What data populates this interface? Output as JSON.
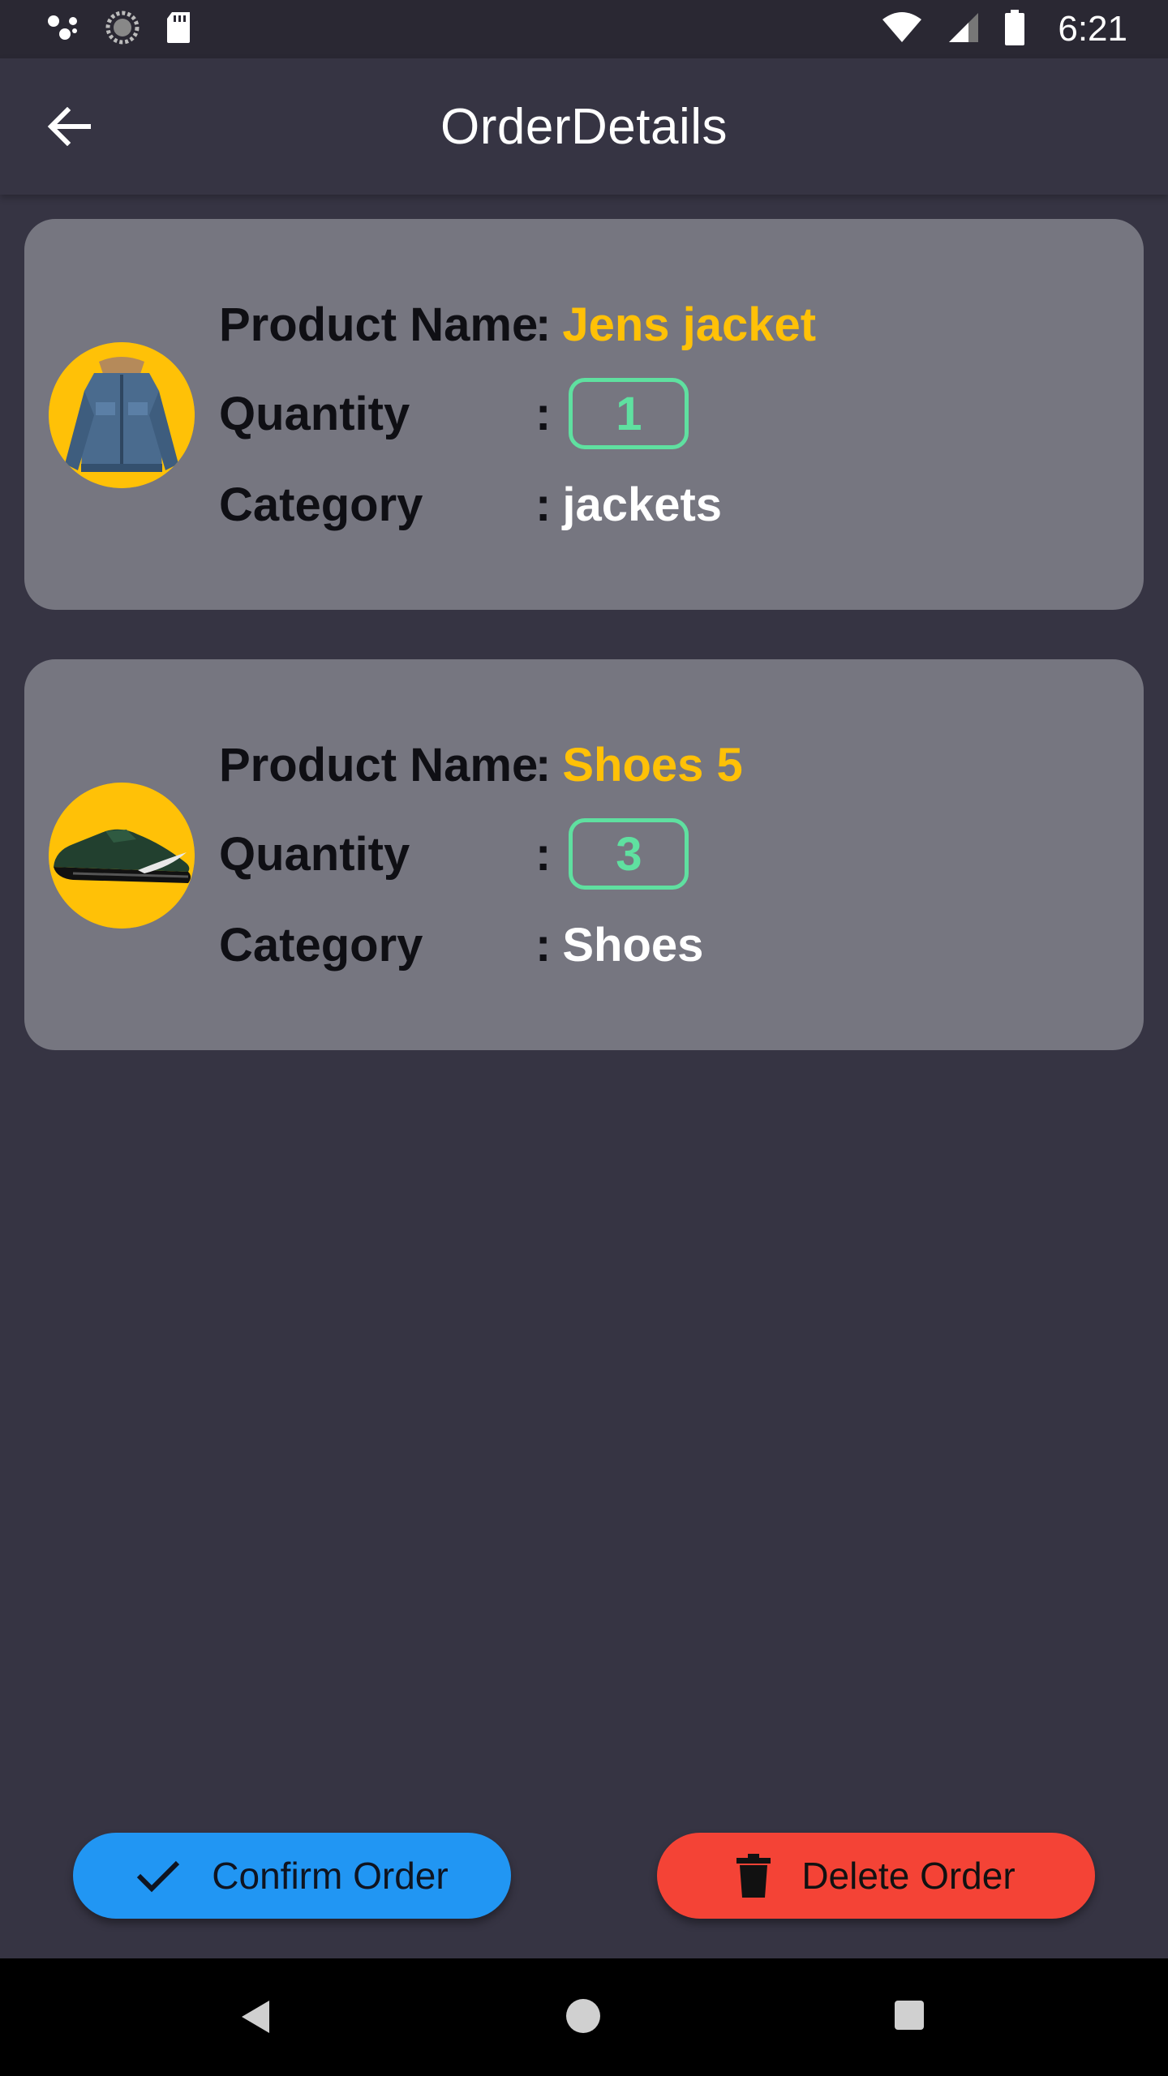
{
  "status_bar": {
    "time": "6:21",
    "icons_left": [
      "assistant-dots-icon",
      "sync-icon",
      "sd-card-icon"
    ],
    "icons_right": [
      "wifi-icon",
      "cell-signal-icon",
      "battery-icon"
    ]
  },
  "app_bar": {
    "title": "OrderDetails",
    "back_icon": "arrow-back-icon"
  },
  "labels": {
    "product_name": "Product Name",
    "quantity": "Quantity",
    "category": "Category",
    "colon": ":"
  },
  "items": [
    {
      "image": "denim-jacket",
      "name": "Jens jacket",
      "quantity": "1",
      "category": "jackets"
    },
    {
      "image": "sneaker",
      "name": "Shoes 5",
      "quantity": "3",
      "category": "Shoes"
    }
  ],
  "actions": {
    "confirm_label": "Confirm Order",
    "delete_label": "Delete Order",
    "confirm_icon": "check-icon",
    "delete_icon": "trash-icon"
  },
  "colors": {
    "background": "#363443",
    "card": "#767680",
    "accent_yellow": "#ffc107",
    "quantity_green": "#5fe0a0",
    "confirm_blue": "#2196f3",
    "delete_red": "#f44336"
  }
}
